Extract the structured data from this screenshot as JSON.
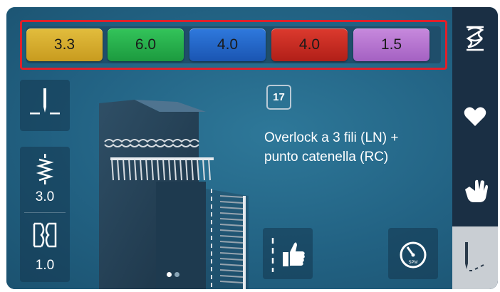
{
  "tensions": [
    {
      "value": "3.3",
      "color": "#d4ab2a"
    },
    {
      "value": "6.0",
      "color": "#22b04a"
    },
    {
      "value": "4.0",
      "color": "#1f66c9"
    },
    {
      "value": "4.0",
      "color": "#c9281f"
    },
    {
      "value": "1.5",
      "color": "#b572cf"
    }
  ],
  "left_panel": {
    "stitch_length": "3.0",
    "differential_feed": "1.0"
  },
  "stitch": {
    "number": "17",
    "title_line1": "Overlock a 3 fili (LN) +",
    "title_line2": "punto catenella (RC)"
  },
  "pager": {
    "total": 2,
    "active": 0
  },
  "icons": {
    "needle": "needle-position-icon",
    "length": "stitch-length-icon",
    "feed": "differential-feed-icon",
    "approve": "thumbs-up-icon",
    "speed": "speed-gauge-icon",
    "stitches": "stitch-patterns-icon",
    "favorites": "heart-icon",
    "manual": "hand-icon",
    "sewing": "needle-sewing-icon"
  },
  "speed_label": "SPM"
}
